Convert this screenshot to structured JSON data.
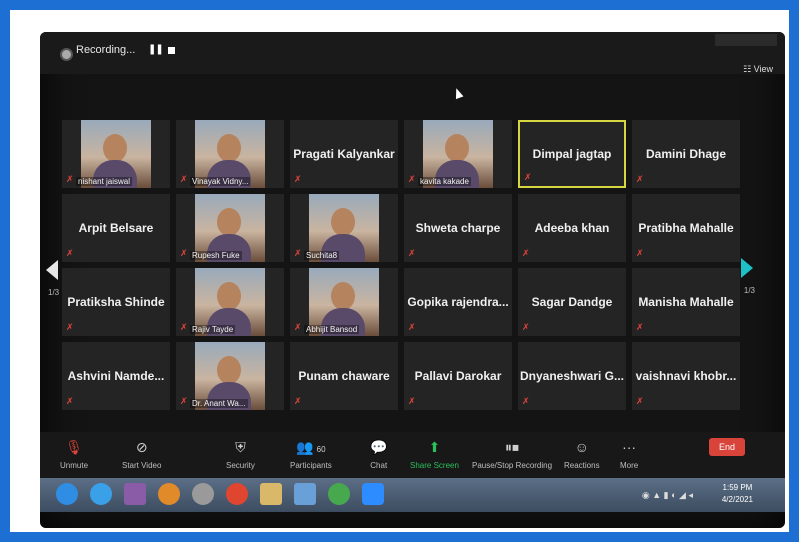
{
  "recording": {
    "label": "Recording...",
    "pause_glyph": "❚❚",
    "view_label": "View"
  },
  "pagination": {
    "left": "1/3",
    "right": "1/3"
  },
  "participants": [
    {
      "name": "nishant jaiswal",
      "kind": "photo",
      "active": false
    },
    {
      "name": "Vinayak Vidny...",
      "kind": "photo",
      "active": false
    },
    {
      "name": "Pragati Kalyankar",
      "kind": "name",
      "active": false
    },
    {
      "name": "kavita kakade",
      "kind": "photo",
      "active": false
    },
    {
      "name": "Dimpal jagtap",
      "kind": "name",
      "active": true
    },
    {
      "name": "Damini Dhage",
      "kind": "name",
      "active": false
    },
    {
      "name": "Arpit Belsare",
      "kind": "name",
      "active": false
    },
    {
      "name": "Rupesh Fuke",
      "kind": "photo",
      "active": false
    },
    {
      "name": "Suchita8",
      "kind": "photo",
      "active": false
    },
    {
      "name": "Shweta charpe",
      "kind": "name",
      "active": false
    },
    {
      "name": "Adeeba khan",
      "kind": "name",
      "active": false
    },
    {
      "name": "Pratibha Mahalle",
      "kind": "name",
      "active": false
    },
    {
      "name": "Pratiksha Shinde",
      "kind": "name",
      "active": false
    },
    {
      "name": "Rajiv Tayde",
      "kind": "photo",
      "active": false
    },
    {
      "name": "Abhijit Bansod",
      "kind": "photo",
      "active": false
    },
    {
      "name": "Gopika rajendra...",
      "kind": "name",
      "active": false
    },
    {
      "name": "Sagar Dandge",
      "kind": "name",
      "active": false
    },
    {
      "name": "Manisha Mahalle",
      "kind": "name",
      "active": false
    },
    {
      "name": "Ashvini Namde...",
      "kind": "name",
      "active": false
    },
    {
      "name": "Dr. Anant Wa...",
      "kind": "photo",
      "active": false
    },
    {
      "name": "Punam chaware",
      "kind": "name",
      "active": false
    },
    {
      "name": "Pallavi Darokar",
      "kind": "name",
      "active": false
    },
    {
      "name": "Dnyaneshwari G...",
      "kind": "name",
      "active": false
    },
    {
      "name": "vaishnavi khobr...",
      "kind": "name",
      "active": false
    }
  ],
  "toolbar": {
    "unmute": "Unmute",
    "start_video": "Start Video",
    "security": "Security",
    "participants": "Participants",
    "participants_count": "60",
    "chat": "Chat",
    "share_screen": "Share Screen",
    "pause_recording": "Pause/Stop Recording",
    "reactions": "Reactions",
    "more": "More",
    "end": "End"
  },
  "taskbar": {
    "time": "1:59 PM",
    "date": "4/2/2021"
  },
  "colors": {
    "accent_active": "#d6d640",
    "end": "#d9443a",
    "share": "#2bbf5a",
    "nav": "#1fc1c8"
  }
}
